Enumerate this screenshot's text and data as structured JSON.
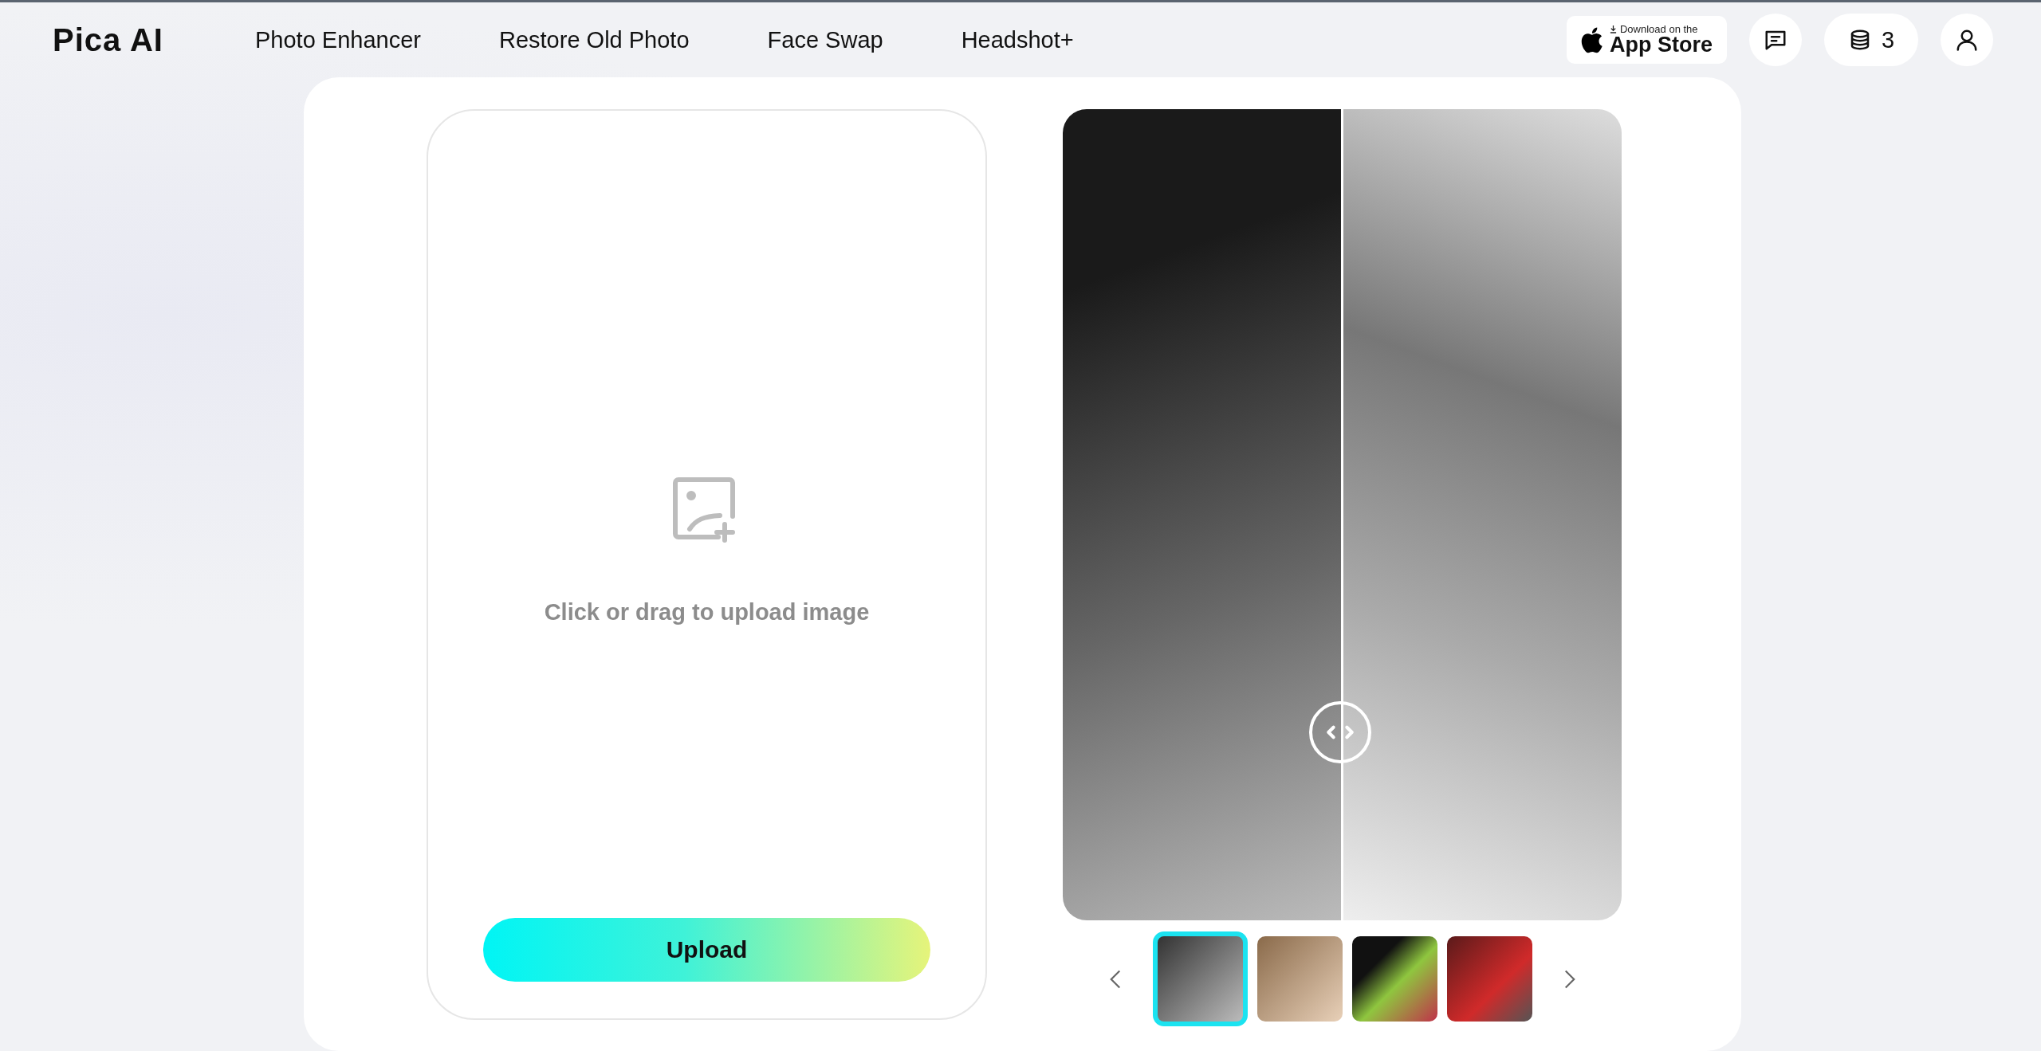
{
  "header": {
    "logo": "Pica AI",
    "nav": [
      {
        "label": "Photo Enhancer"
      },
      {
        "label": "Restore Old Photo"
      },
      {
        "label": "Face Swap"
      },
      {
        "label": "Headshot+"
      }
    ],
    "app_store": {
      "small": "Download on the",
      "big": "App Store"
    },
    "credits": "3"
  },
  "upload": {
    "hint": "Click or drag to upload image",
    "button": "Upload"
  },
  "thumbnails": [
    {
      "kind": "bw",
      "selected": true
    },
    {
      "kind": "warm",
      "selected": false
    },
    {
      "kind": "green",
      "selected": false
    },
    {
      "kind": "red",
      "selected": false
    }
  ]
}
